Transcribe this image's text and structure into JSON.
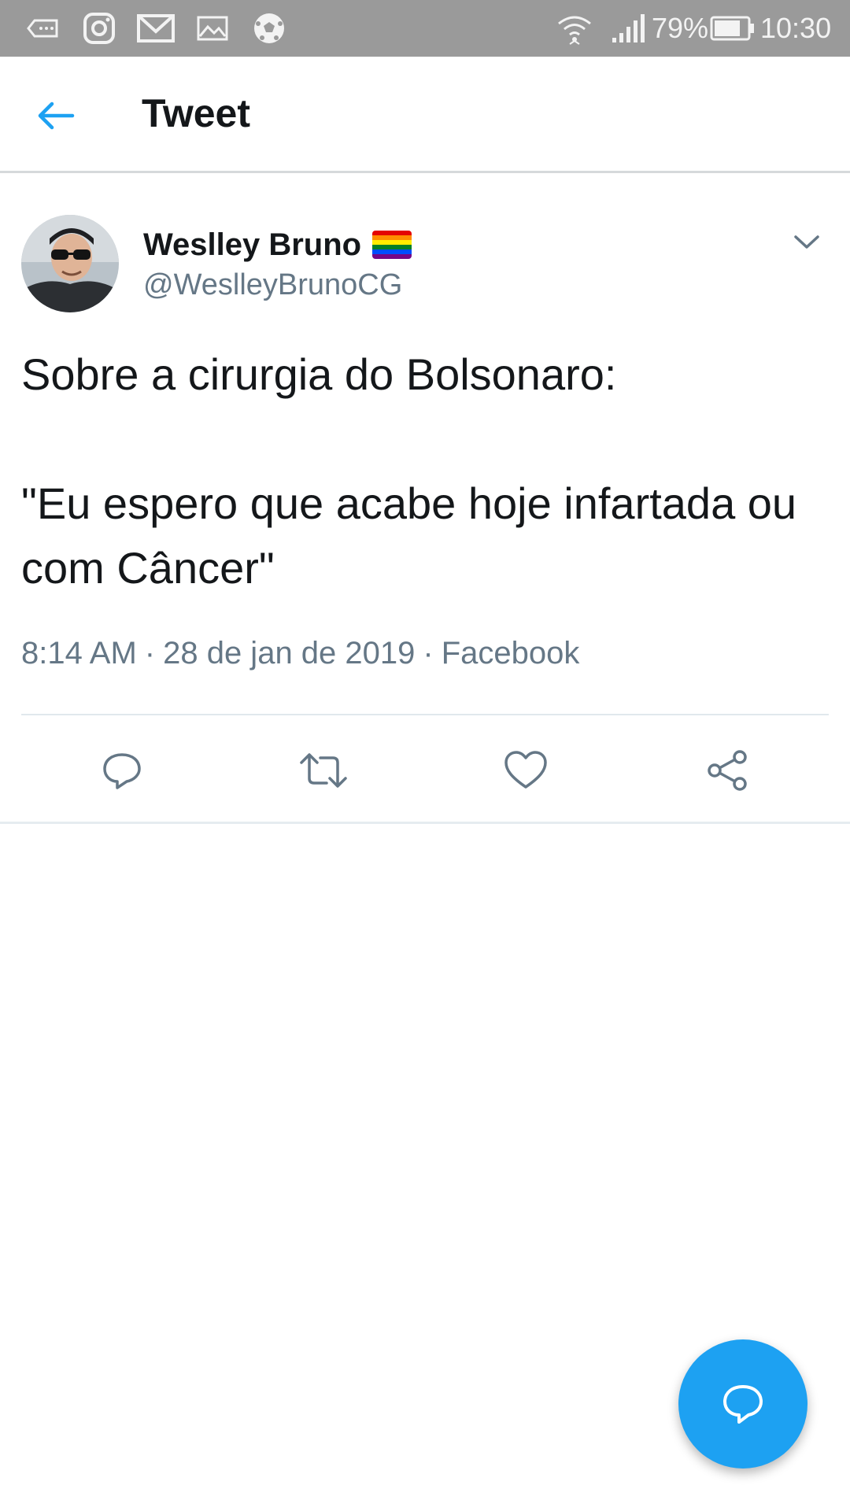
{
  "status_bar": {
    "battery": "79%",
    "time": "10:30"
  },
  "header": {
    "title": "Tweet"
  },
  "tweet": {
    "author_name": "Weslley Bruno",
    "author_handle": "@WeslleyBrunoCG",
    "text": "Sobre a cirurgia do Bolsonaro:\n\n\"Eu espero que acabe hoje infartada ou com Câncer\"",
    "time": "8:14 AM",
    "date": "28 de jan de 2019",
    "source": "Facebook",
    "separator": "·"
  },
  "icons": {
    "back": "arrow-left-icon",
    "menu": "chevron-down-icon",
    "reply": "reply-icon",
    "retweet": "retweet-icon",
    "like": "heart-icon",
    "share": "share-icon",
    "compose": "compose-reply-icon"
  },
  "colors": {
    "accent": "#1da1f2",
    "status_bar": "#9a9a9a",
    "text_primary": "#14171a",
    "text_secondary": "#657786"
  }
}
